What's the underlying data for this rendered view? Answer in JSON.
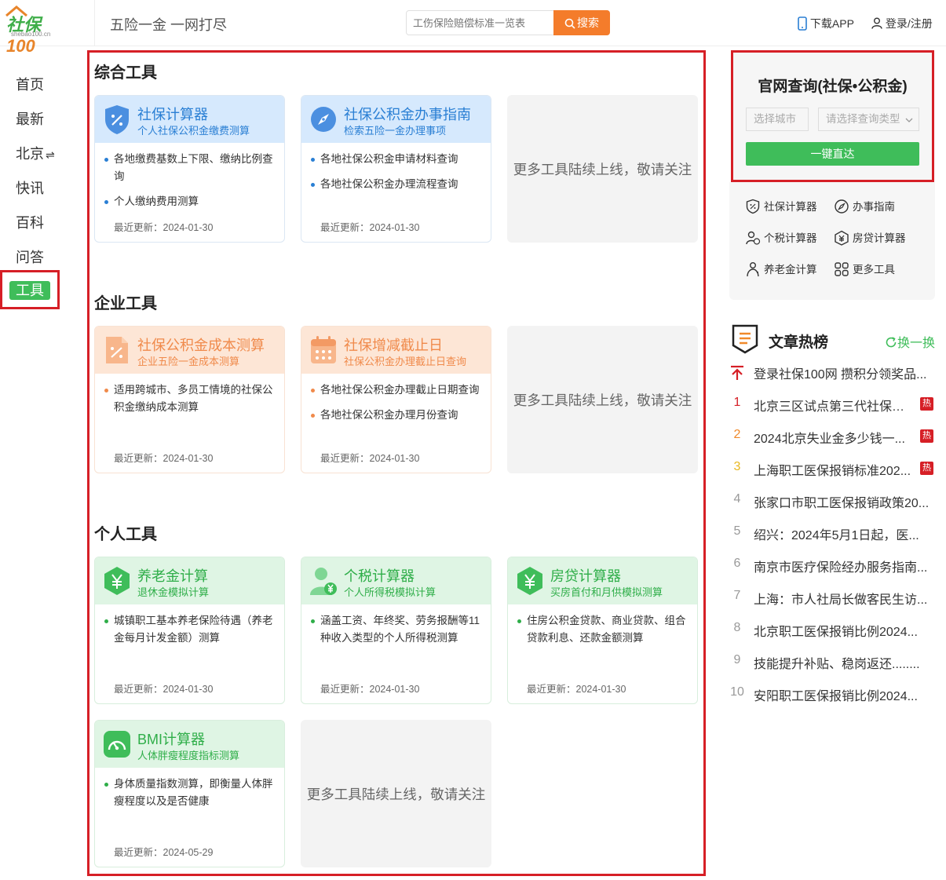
{
  "header": {
    "logo_text": "社保100",
    "logo_sub": "shebao100.cn",
    "slogan": "五险一金 一网打尽",
    "search_placeholder": "工伤保险赔偿标准一览表",
    "search_label": "搜索",
    "download_label": "下载APP",
    "login_label": "登录/注册"
  },
  "nav": {
    "items": [
      "首页",
      "最新",
      "北京",
      "快讯",
      "百科",
      "问答"
    ],
    "city_switch_icon": "⇌",
    "active": "工具"
  },
  "sections": {
    "general_title": "综合工具",
    "enterprise_title": "企业工具",
    "personal_title": "个人工具"
  },
  "cards": [
    {
      "title": "社保计算器",
      "sub": "个人社保公积金缴费测算",
      "icon": "shield-percent-icon",
      "color": "blue",
      "items": [
        "各地缴费基数上下限、缴纳比例查询",
        "个人缴纳费用测算"
      ],
      "date": "最近更新：2024-01-30"
    },
    {
      "title": "社保公积金办事指南",
      "sub": "检索五险一金办理事项",
      "icon": "compass-icon",
      "color": "blue",
      "items": [
        "各地社保公积金申请材料查询",
        "各地社保公积金办理流程查询"
      ],
      "date": "最近更新：2024-01-30"
    },
    {
      "title": "社保公积金成本测算",
      "sub": "企业五险一金成本测算",
      "icon": "document-percent-icon",
      "color": "orange",
      "items": [
        "适用跨城市、多员工情境的社保公积金缴纳成本测算"
      ],
      "date": "最近更新：2024-01-30"
    },
    {
      "title": "社保增减截止日",
      "sub": "社保公积金办理截止日查询",
      "icon": "calendar-icon",
      "color": "orange",
      "items": [
        "各地社保公积金办理截止日期查询",
        "各地社保公积金办理月份查询"
      ],
      "date": "最近更新：2024-01-30"
    },
    {
      "title": "养老金计算",
      "sub": "退休金模拟计算",
      "icon": "yuan-hexagon-icon",
      "color": "green",
      "items": [
        "城镇职工基本养老保险待遇（养老金每月计发金额）测算"
      ],
      "date": "最近更新：2024-01-30"
    },
    {
      "title": "个税计算器",
      "sub": "个人所得税模拟计算",
      "icon": "person-yuan-icon",
      "color": "green",
      "items": [
        "涵盖工资、年终奖、劳务报酬等11种收入类型的个人所得税测算"
      ],
      "date": "最近更新：2024-01-30"
    },
    {
      "title": "房贷计算器",
      "sub": "买房首付和月供模拟测算",
      "icon": "yuan-hexagon-icon",
      "color": "green",
      "items": [
        "住房公积金贷款、商业贷款、组合贷款利息、还款金额测算"
      ],
      "date": "最近更新：2024-01-30"
    },
    {
      "title": "BMI计算器",
      "sub": "人体胖瘦程度指标测算",
      "icon": "gauge-icon",
      "color": "green",
      "items": [
        "身体质量指数测算，即衡量人体胖瘦程度以及是否健康"
      ],
      "date": "最近更新：2024-05-29"
    }
  ],
  "more_text": "更多工具陆续上线，敬请关注",
  "query": {
    "title": "官网查询(社保•公积金)",
    "city_placeholder": "选择城市",
    "type_placeholder": "请选择查询类型",
    "button": "一键直达"
  },
  "quick_tools": [
    "社保计算器",
    "办事指南",
    "个税计算器",
    "房贷计算器",
    "养老金计算",
    "更多工具"
  ],
  "hot": {
    "title": "文章热榜",
    "refresh": "换一换",
    "badge": "热",
    "items": [
      {
        "rank": "",
        "text": "登录社保100网 攒积分领奖品..."
      },
      {
        "rank": "1",
        "text": "北京三区试点第三代社保卡...",
        "hot": true
      },
      {
        "rank": "2",
        "text": "2024北京失业金多少钱一...",
        "hot": true
      },
      {
        "rank": "3",
        "text": "上海职工医保报销标准202...",
        "hot": true
      },
      {
        "rank": "4",
        "text": "张家口市职工医保报销政策20..."
      },
      {
        "rank": "5",
        "text": "绍兴：2024年5月1日起，医..."
      },
      {
        "rank": "6",
        "text": "南京市医疗保险经办服务指南..."
      },
      {
        "rank": "7",
        "text": "上海：市人社局长做客民生访..."
      },
      {
        "rank": "8",
        "text": "北京职工医保报销比例2024..."
      },
      {
        "rank": "9",
        "text": "技能提升补贴、稳岗返还........"
      },
      {
        "rank": "10",
        "text": "安阳职工医保报销比例2024..."
      }
    ],
    "rank_colors": {
      "1": "#d61f26",
      "2": "#f08a2b",
      "3": "#e8b820"
    }
  }
}
